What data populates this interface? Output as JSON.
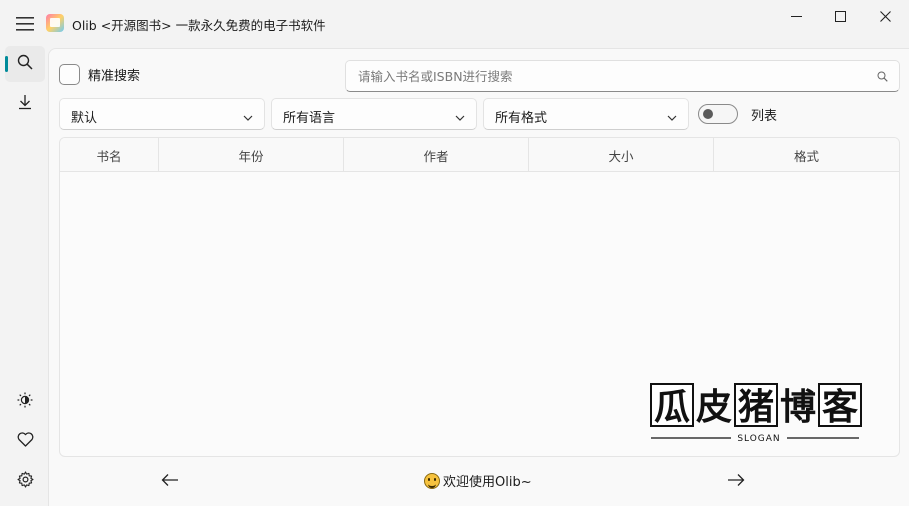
{
  "window": {
    "title": "Olib <开源图书> 一款永久免费的电子书软件",
    "minimize_icon": "minimize-icon",
    "maximize_icon": "maximize-icon",
    "close_icon": "close-icon"
  },
  "sidebar": {
    "menu_icon": "hamburger-menu-icon",
    "items": [
      {
        "name": "search",
        "icon": "search-icon",
        "active": true
      },
      {
        "name": "download",
        "icon": "download-icon",
        "active": false
      }
    ],
    "bottom_items": [
      {
        "name": "theme",
        "icon": "brightness-icon"
      },
      {
        "name": "favorites",
        "icon": "heart-icon"
      },
      {
        "name": "settings",
        "icon": "gear-icon"
      }
    ],
    "accent_color": "#008b9a"
  },
  "search": {
    "exact_label": "精准搜索",
    "exact_checked": false,
    "placeholder": "请输入书名或ISBN进行搜索",
    "value": ""
  },
  "filters": {
    "sort": "默认",
    "language": "所有语言",
    "format": "所有格式",
    "list_toggle_label": "列表",
    "list_toggle_on": false
  },
  "table": {
    "columns": [
      "书名",
      "年份",
      "作者",
      "大小",
      "格式"
    ],
    "rows": []
  },
  "watermark": {
    "text": "瓜皮猪博客",
    "slogan": "SLOGAN"
  },
  "footer": {
    "prev_icon": "arrow-left-icon",
    "next_icon": "arrow-right-icon",
    "welcome": "欢迎使用Olib~"
  }
}
